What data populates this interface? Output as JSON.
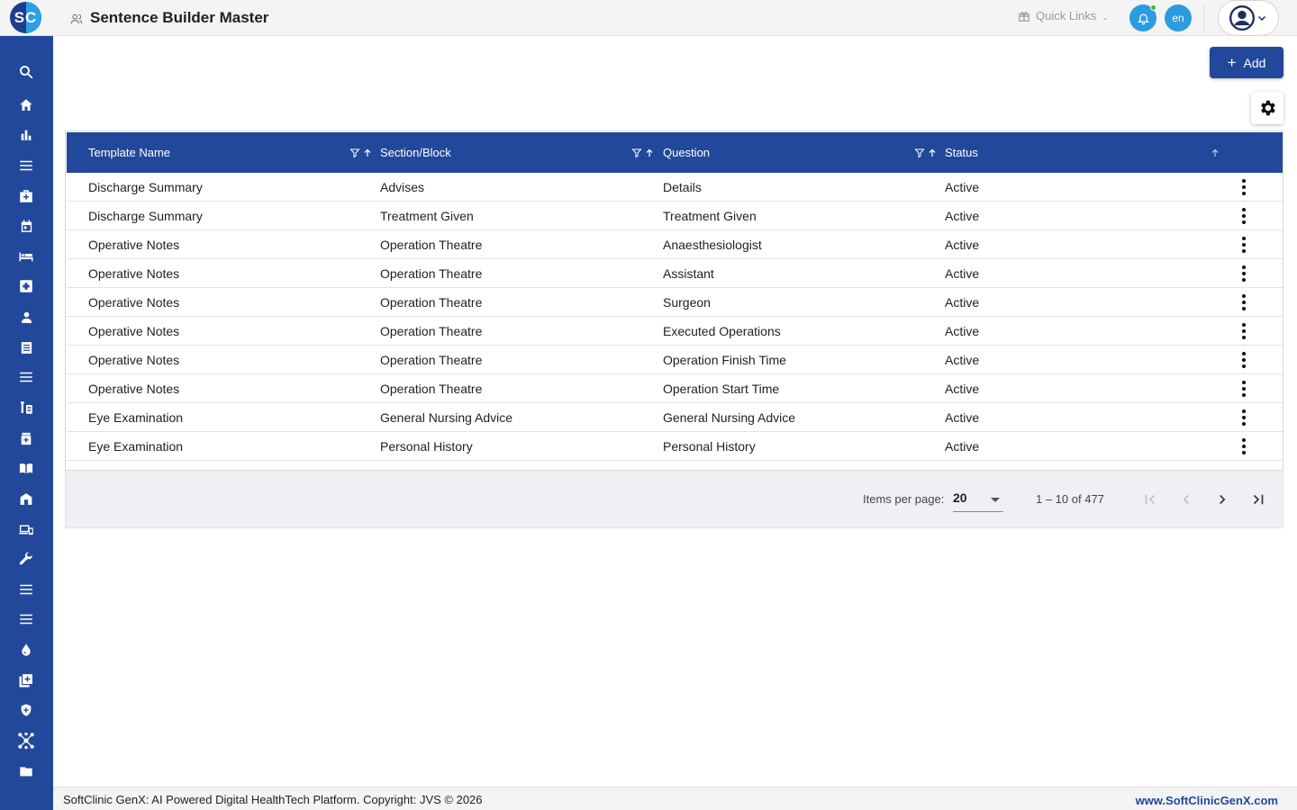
{
  "header": {
    "logo_text": "SC",
    "page_title": "Sentence Builder Master",
    "quick_links_label": "Quick Links",
    "language": "en"
  },
  "sidebar": {
    "items": [
      {
        "name": "search-icon"
      },
      {
        "name": "home-icon"
      },
      {
        "name": "bar-chart-icon"
      },
      {
        "name": "menu-icon"
      },
      {
        "name": "medical-bag-icon"
      },
      {
        "name": "calendar-icon"
      },
      {
        "name": "bed-icon"
      },
      {
        "name": "medical-cross-icon"
      },
      {
        "name": "person-icon"
      },
      {
        "name": "document-icon"
      },
      {
        "name": "menu-icon"
      },
      {
        "name": "lab-icon"
      },
      {
        "name": "medicine-icon"
      },
      {
        "name": "book-icon"
      },
      {
        "name": "store-icon"
      },
      {
        "name": "devices-icon"
      },
      {
        "name": "wrench-icon"
      },
      {
        "name": "menu-icon"
      },
      {
        "name": "menu-icon"
      },
      {
        "name": "blood-drop-icon"
      },
      {
        "name": "add-box-icon"
      },
      {
        "name": "shield-icon"
      },
      {
        "name": "network-icon"
      },
      {
        "name": "folder-icon"
      }
    ]
  },
  "toolbar": {
    "add_label": "Add"
  },
  "table": {
    "columns": [
      "Template Name",
      "Section/Block",
      "Question",
      "Status"
    ],
    "rows": [
      [
        "Discharge Summary",
        "Advises",
        "Details",
        "Active"
      ],
      [
        "Discharge Summary",
        "Treatment Given",
        "Treatment Given",
        "Active"
      ],
      [
        "Operative Notes",
        "Operation Theatre",
        "Anaesthesiologist",
        "Active"
      ],
      [
        "Operative Notes",
        "Operation Theatre",
        "Assistant",
        "Active"
      ],
      [
        "Operative Notes",
        "Operation Theatre",
        "Surgeon",
        "Active"
      ],
      [
        "Operative Notes",
        "Operation Theatre",
        "Executed Operations",
        "Active"
      ],
      [
        "Operative Notes",
        "Operation Theatre",
        "Operation Finish Time",
        "Active"
      ],
      [
        "Operative Notes",
        "Operation Theatre",
        "Operation Start Time",
        "Active"
      ],
      [
        "Eye Examination",
        "General Nursing Advice",
        "General Nursing Advice",
        "Active"
      ],
      [
        "Eye Examination",
        "Personal History",
        "Personal History",
        "Active"
      ]
    ]
  },
  "paginator": {
    "items_per_page_label": "Items per page:",
    "items_per_page": "20",
    "range_label": "1 – 10 of 477"
  },
  "footer": {
    "copyright": "SoftClinic GenX: AI Powered Digital HealthTech Platform. Copyright: JVS © 2026",
    "website": "www.SoftClinicGenX.com"
  },
  "colors": {
    "primary": "#22489c",
    "accent": "#2c9be0",
    "notification_dot": "#3bb54a"
  }
}
